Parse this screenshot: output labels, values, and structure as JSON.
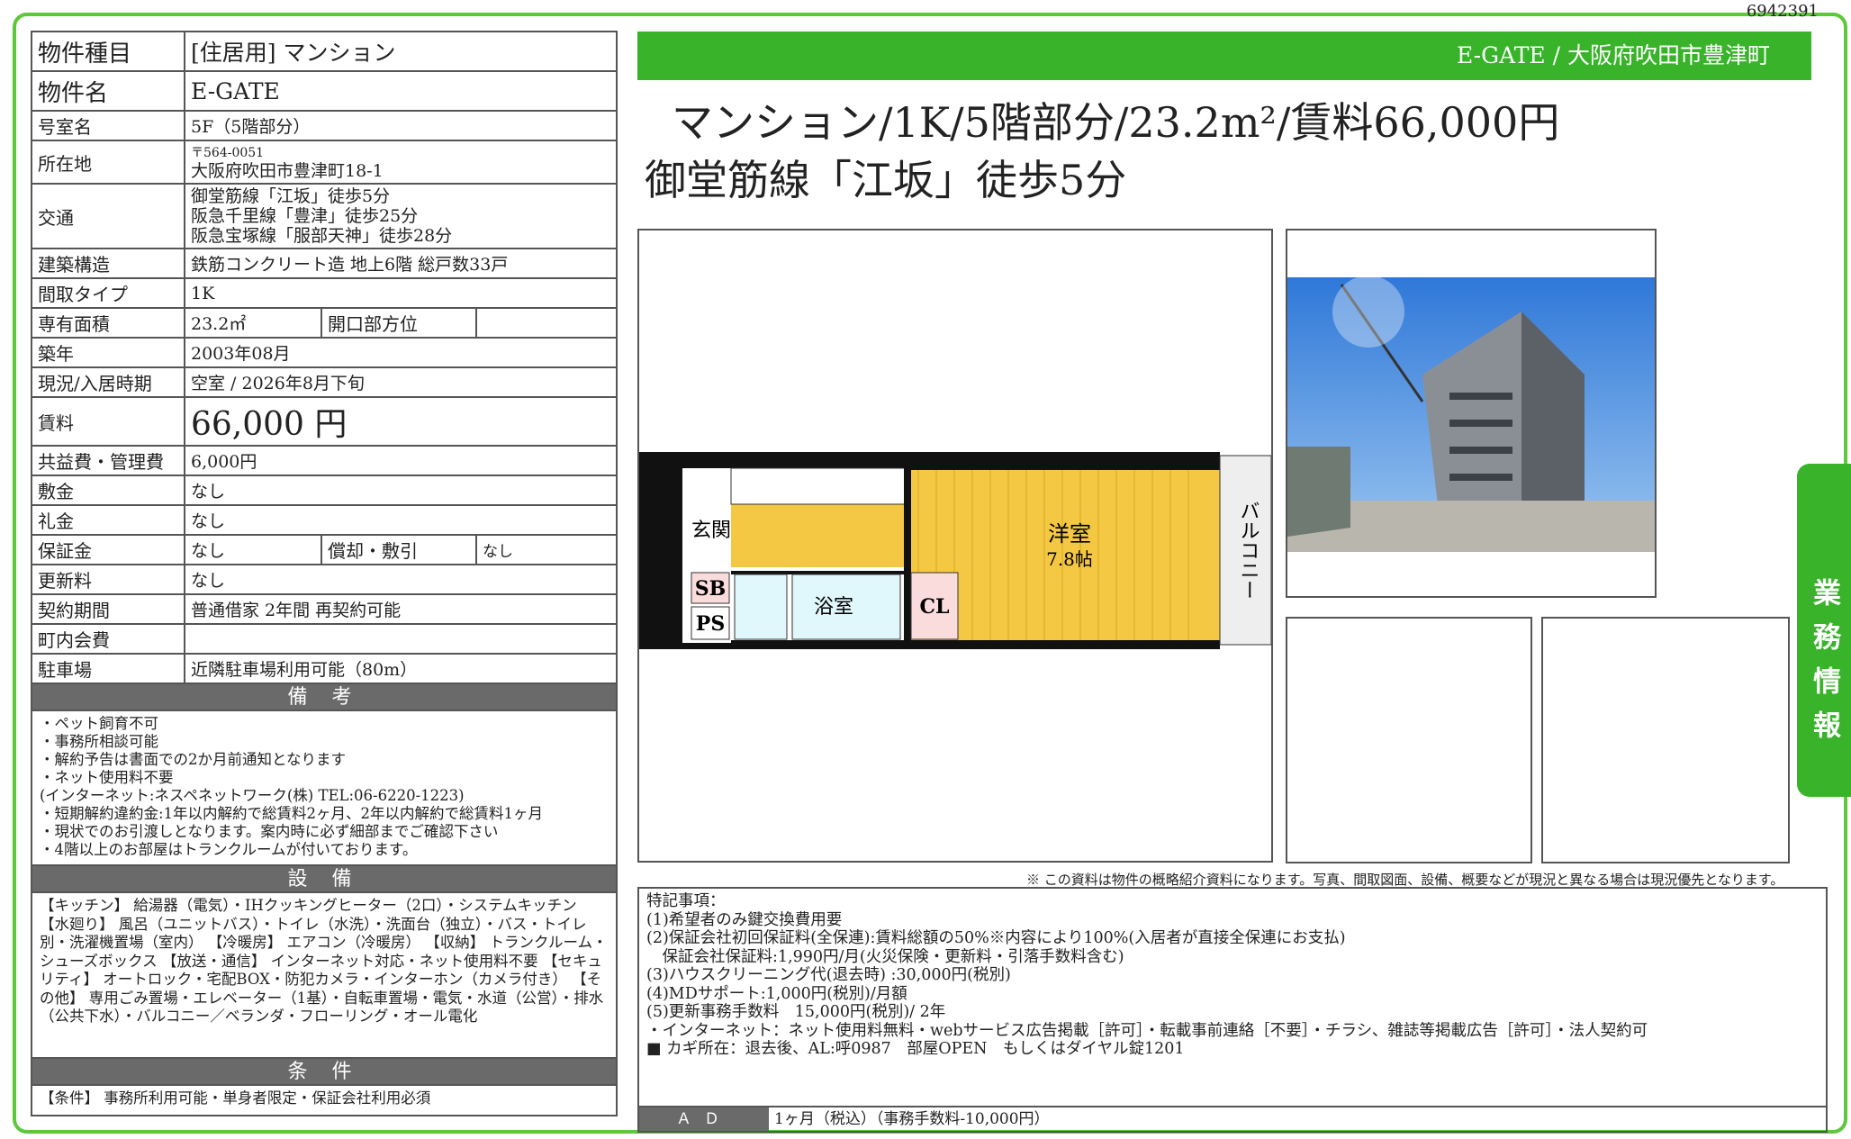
{
  "doc_id": "6942391",
  "spec": {
    "type_label": "物件種目",
    "type_value": "[住居用] マンション",
    "name_label": "物件名",
    "name_value": "E-GATE",
    "room_label": "号室名",
    "room_value": "5F（5階部分）",
    "address_label": "所在地",
    "postal": "〒564-0051",
    "address_value": "大阪府吹田市豊津町18-1",
    "transport_label": "交通",
    "transport": [
      "御堂筋線「江坂」徒歩5分",
      "阪急千里線「豊津」徒歩25分",
      "阪急宝塚線「服部天神」徒歩28分"
    ],
    "structure_label": "建築構造",
    "structure_value": "鉄筋コンクリート造 地上6階 総戸数33戸",
    "layout_label": "間取タイプ",
    "layout_value": "1K",
    "area_label": "専有面積",
    "area_value": "23.2㎡",
    "opening_label": "開口部方位",
    "opening_value": "",
    "built_label": "築年",
    "built_value": "2003年08月",
    "status_label": "現況/入居時期",
    "status_value": "空室 / 2026年8月下旬",
    "rent_label": "賃料",
    "rent_value": "66,000 円",
    "fee_label": "共益費・管理費",
    "fee_value": "6,000円",
    "deposit_label": "敷金",
    "deposit_value": "なし",
    "key_money_label": "礼金",
    "key_money_value": "なし",
    "guarantee_label": "保証金",
    "guarantee_value": "なし",
    "amort_label": "償却・敷引",
    "amort_value": "なし",
    "renewal_label": "更新料",
    "renewal_value": "なし",
    "contract_label": "契約期間",
    "contract_value": "普通借家 2年間 再契約可能",
    "association_label": "町内会費",
    "association_value": "",
    "parking_label": "駐車場",
    "parking_value": "近隣駐車場利用可能（80m）"
  },
  "remarks": {
    "title": "備 考",
    "lines": [
      "・ペット飼育不可",
      "・事務所相談可能",
      "・解約予告は書面での2か月前通知となります",
      "・ネット使用料不要",
      "(インターネット:ネスペネットワーク(株) TEL:06-6220-1223)",
      "・短期解約違約金:1年以内解約で総賃料2ヶ月、2年以内解約で総賃料1ヶ月",
      "・現状でのお引渡しとなります。案内時に必ず細部までご確認下さい",
      "・4階以上のお部屋はトランクルームが付いております。"
    ]
  },
  "equipment": {
    "title": "設 備",
    "text": "【キッチン】 給湯器（電気）・IHクッキングヒーター（2口）・システムキッチン 【水廻り】 風呂（ユニットバス）・トイレ（水洗）・洗面台（独立）・バス・トイレ別・洗濯機置場（室内） 【冷暖房】 エアコン（冷暖房） 【収納】 トランクルーム・シューズボックス 【放送・通信】 インターネット対応・ネット使用料不要 【セキュリティ】 オートロック・宅配BOX・防犯カメラ・インターホン（カメラ付き） 【その他】 専用ごみ置場・エレベーター（1基）・自転車置場・電気・水道（公営）・排水（公共下水）・バルコニー／ベランダ・フローリング・オール電化"
  },
  "conditions": {
    "title": "条 件",
    "text": "【条件】 事務所利用可能・単身者限定・保証会社利用必須"
  },
  "banner": {
    "text": "E-GATE /  大阪府吹田市豊津町"
  },
  "headline": {
    "line1": "マンション/1K/5階部分/23.2m²/賃料66,000円",
    "line2": "御堂筋線「江坂」徒歩5分"
  },
  "floorplan": {
    "rooms": {
      "entrance": "玄関",
      "sb": "SB",
      "ps": "PS",
      "bath": "浴室",
      "cl": "CL",
      "western": "洋室",
      "western_size": "7.8帖",
      "balcony": "バルコニー"
    }
  },
  "side_tab": "業務情報",
  "disclaimer": "※ この資料は物件の概略紹介資料になります。写真、間取図面、設備、概要などが現況と異なる場合は現況優先となります。",
  "notes": {
    "lines": [
      "特記事項：",
      "(1)希望者のみ鍵交換費用要",
      "(2)保証会社初回保証料(全保連):賃料総額の50%※内容により100%(入居者が直接全保連にお支払)",
      "　保証会社保証料:1,990円/月(火災保険・更新料・引落手数料含む)",
      "(3)ハウスクリーニング代(退去時) :30,000円(税別)",
      "(4)MDサポート:1,000円(税別)/月額",
      "(5)更新事務手数料　15,000円(税別)/ 2年",
      "・インターネット：ネット使用料無料・webサービス広告掲載［許可］・転載事前連絡［不要］・チラシ、雑誌等掲載広告［許可］・法人契約可",
      "■ カギ所在：退去後、AL:呼0987　部屋OPEN　もしくはダイヤル錠1201"
    ]
  },
  "ad": {
    "label": "ＡＤ",
    "value": "1ヶ月（税込）（事務手数料-10,000円）"
  }
}
